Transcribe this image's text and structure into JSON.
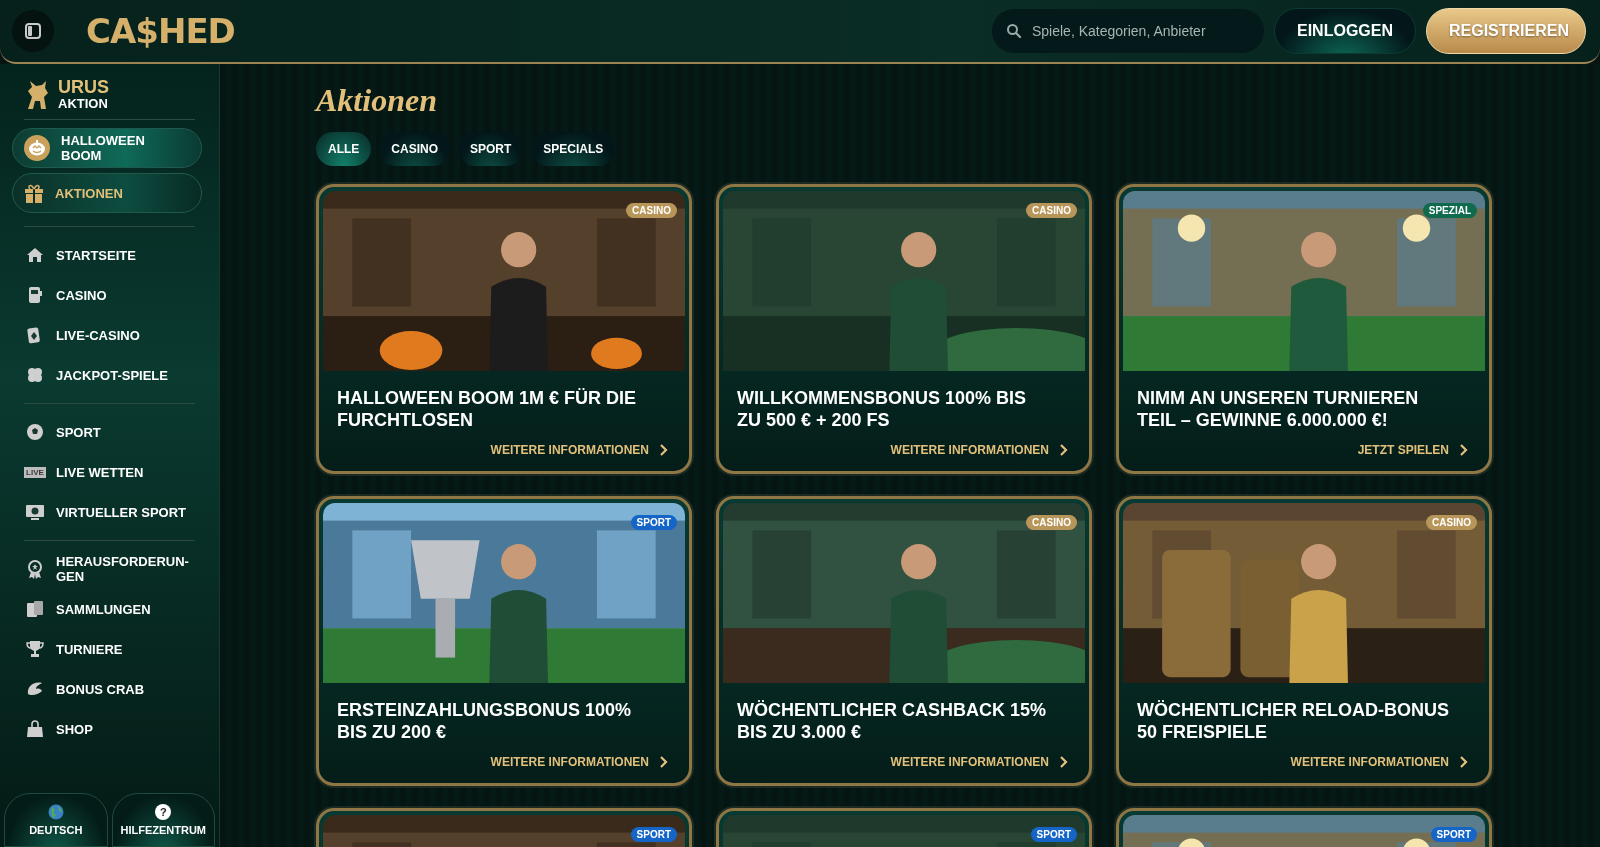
{
  "header": {
    "logo": "CA$HED",
    "search": {
      "placeholder": "Spiele, Kategorien, Anbieter"
    },
    "buttons": [
      {
        "label": "EINLOGGEN",
        "kind": "secondary"
      },
      {
        "label": "REGISTRIEREN",
        "kind": "primary"
      }
    ]
  },
  "sidebar": {
    "promo": {
      "title": "URUS",
      "subtitle": "AKTION"
    },
    "featured": [
      {
        "label": "HALLOWEEN BOOM",
        "selected": false
      },
      {
        "label": "AKTIONEN",
        "selected": true
      }
    ],
    "groups": [
      [
        {
          "label": "STARTSEITE"
        },
        {
          "label": "CASINO"
        },
        {
          "label": "LIVE-CASINO"
        },
        {
          "label": "JACKPOT-SPIELE"
        }
      ],
      [
        {
          "label": "SPORT"
        },
        {
          "label": "LIVE WETTEN",
          "icon_text": "LIVE"
        },
        {
          "label": "VIRTUELLER SPORT"
        }
      ],
      [
        {
          "label": "HERAUSFORDERUN-GEN"
        },
        {
          "label": "SAMMLUNGEN"
        },
        {
          "label": "TURNIERE"
        },
        {
          "label": "BONUS CRAB"
        },
        {
          "label": "SHOP"
        }
      ]
    ],
    "footer": [
      {
        "label": "DEUTSCH"
      },
      {
        "label": "HILFEZENTRUM",
        "icon_text": "?"
      }
    ]
  },
  "page": {
    "title": "Aktionen",
    "filters": [
      {
        "label": "ALLE",
        "selected": true
      },
      {
        "label": "CASINO",
        "selected": false
      },
      {
        "label": "SPORT",
        "selected": false
      },
      {
        "label": "SPECIALS",
        "selected": false
      }
    ],
    "cards": [
      {
        "badge": {
          "label": "CASINO",
          "color": "#b8965a"
        },
        "title": "HALLOWEEN BOOM 1M € FÜR DIE FURCHTLOSEN",
        "link": "WEITERE INFORMATIONEN"
      },
      {
        "badge": {
          "label": "CASINO",
          "color": "#b8965a"
        },
        "title": "WILLKOMMENSBONUS 100% BIS ZU 500 € + 200 FS",
        "link": "WEITERE INFORMATIONEN"
      },
      {
        "badge": {
          "label": "SPEZIAL",
          "color": "#0f6b4e"
        },
        "title": "NIMM AN UNSEREN TURNIEREN TEIL – GEWINNE 6.000.000 €!",
        "link": "JETZT SPIELEN"
      },
      {
        "badge": {
          "label": "SPORT",
          "color": "#1565c8"
        },
        "title": "ERSTEINZAHLUNGSBONUS 100% BIS ZU 200 €",
        "link": "WEITERE INFORMATIONEN"
      },
      {
        "badge": {
          "label": "CASINO",
          "color": "#b8965a"
        },
        "title": "WÖCHENTLICHER CASHBACK 15% BIS ZU 3.000 €",
        "link": "WEITERE INFORMATIONEN"
      },
      {
        "badge": {
          "label": "CASINO",
          "color": "#b8965a"
        },
        "title": "WÖCHENTLICHER RELOAD-BONUS 50 FREISPIELE",
        "link": "WEITERE INFORMATIONEN"
      },
      {
        "badge": {
          "label": "SPORT",
          "color": "#1565c8"
        }
      },
      {
        "badge": {
          "label": "SPORT",
          "color": "#1565c8"
        }
      },
      {
        "badge": {
          "label": "SPORT",
          "color": "#1565c8"
        }
      }
    ]
  }
}
